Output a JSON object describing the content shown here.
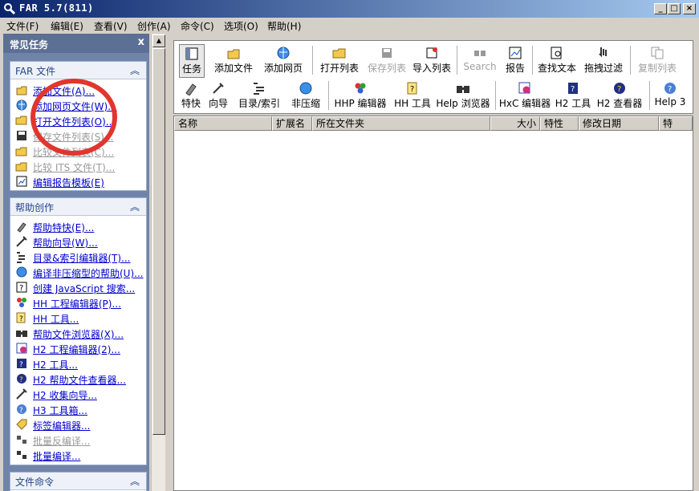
{
  "window": {
    "title": "FAR 5.7(811)",
    "minimize": "_",
    "maximize": "□",
    "close": "×"
  },
  "menu": [
    "文件(F)",
    "编辑(E)",
    "查看(V)",
    "创作(A)",
    "命令(C)",
    "选项(O)",
    "帮助(H)"
  ],
  "taskpane": {
    "title": "常见任务",
    "close": "x",
    "groups": [
      {
        "title": "FAR 文件",
        "items": [
          {
            "label": "添加文件(A)...",
            "icon": "add-file-icon",
            "disabled": false
          },
          {
            "label": "添加网页文件(W)...",
            "icon": "add-web-icon",
            "disabled": false
          },
          {
            "label": "打开文件列表(O)...",
            "icon": "open-list-icon",
            "disabled": false
          },
          {
            "label": "保存文件列表(S)...",
            "icon": "save-icon",
            "disabled": true
          },
          {
            "label": "比较文件列表(C)...",
            "icon": "compare-list-icon",
            "disabled": true
          },
          {
            "label": "比较 ITS 文件(T)...",
            "icon": "compare-its-icon",
            "disabled": true
          },
          {
            "label": "编辑报告模板(E)",
            "icon": "report-template-icon",
            "disabled": false
          }
        ]
      },
      {
        "title": "帮助创作",
        "items": [
          {
            "label": "帮助特快(E)...",
            "icon": "express-icon",
            "disabled": false
          },
          {
            "label": "帮助向导(W)...",
            "icon": "wizard-icon",
            "disabled": false
          },
          {
            "label": "目录&索引编辑器(T)...",
            "icon": "toc-index-icon",
            "disabled": false
          },
          {
            "label": "编译非压缩型的帮助(U)...",
            "icon": "compile-icon",
            "disabled": false
          },
          {
            "label": "创建 JavaScript 搜索...",
            "icon": "js-search-icon",
            "disabled": false
          },
          {
            "label": "HH 工程编辑器(P)...",
            "icon": "hh-project-icon",
            "disabled": false
          },
          {
            "label": "HH 工具...",
            "icon": "hh-tools-icon",
            "disabled": false
          },
          {
            "label": "帮助文件浏览器(X)...",
            "icon": "help-browser-icon",
            "disabled": false
          },
          {
            "label": "H2 工程编辑器(2)...",
            "icon": "h2-project-icon",
            "disabled": false
          },
          {
            "label": "H2 工具...",
            "icon": "h2-tools-icon",
            "disabled": false
          },
          {
            "label": "H2 帮助文件查看器...",
            "icon": "h2-viewer-icon",
            "disabled": false
          },
          {
            "label": "H2 收集向导...",
            "icon": "h2-collect-icon",
            "disabled": false
          },
          {
            "label": "H3 工具箱...",
            "icon": "h3-toolbox-icon",
            "disabled": false
          },
          {
            "label": "标签编辑器...",
            "icon": "tag-editor-icon",
            "disabled": false
          },
          {
            "label": "批量反编译...",
            "icon": "batch-decompile-icon",
            "disabled": true
          },
          {
            "label": "批量编译...",
            "icon": "batch-compile-icon",
            "disabled": false
          }
        ]
      },
      {
        "title": "文件命令",
        "items": []
      }
    ]
  },
  "toolbar": {
    "row1": [
      {
        "label": "任务",
        "icon": "tasks-icon",
        "disabled": false,
        "selected": true
      },
      {
        "label": "添加文件",
        "icon": "add-file-icon",
        "disabled": false
      },
      {
        "label": "添加网页",
        "icon": "add-web-icon",
        "disabled": false
      },
      {
        "label": "打开列表",
        "icon": "open-list-icon",
        "disabled": false
      },
      {
        "label": "保存列表",
        "icon": "save-list-icon",
        "disabled": true
      },
      {
        "label": "导入列表",
        "icon": "import-list-icon",
        "disabled": false
      },
      {
        "label": "Search",
        "icon": "search-icon",
        "disabled": true
      },
      {
        "label": "报告",
        "icon": "report-icon",
        "disabled": false
      },
      {
        "label": "查找文本",
        "icon": "find-text-icon",
        "disabled": false
      },
      {
        "label": "拖拽过滤",
        "icon": "drag-filter-icon",
        "disabled": false
      },
      {
        "label": "复制列表",
        "icon": "copy-list-icon",
        "disabled": true
      }
    ],
    "row2": [
      {
        "label": "特快",
        "icon": "express-icon"
      },
      {
        "label": "向导",
        "icon": "wizard-icon"
      },
      {
        "label": "目录/索引",
        "icon": "toc-index-icon"
      },
      {
        "label": "非压缩",
        "icon": "uncompressed-icon"
      },
      {
        "label": "HHP 编辑器",
        "icon": "hhp-editor-icon"
      },
      {
        "label": "HH 工具",
        "icon": "hh-tools-icon"
      },
      {
        "label": "Help 浏览器",
        "icon": "help-browser-icon"
      },
      {
        "label": "HxC 编辑器",
        "icon": "hxc-editor-icon"
      },
      {
        "label": "H2 工具",
        "icon": "h2-tools-icon"
      },
      {
        "label": "H2 查看器",
        "icon": "h2-viewer-icon"
      },
      {
        "label": "Help 3",
        "icon": "help3-icon"
      }
    ]
  },
  "listview": {
    "columns": [
      "名称",
      "扩展名",
      "所在文件夹",
      "大小",
      "特性",
      "修改日期",
      "特"
    ]
  },
  "colors": {
    "annotation_circle": "#e0362e",
    "link": "#0000cc",
    "taskpane_bg": "#6f84a8"
  }
}
